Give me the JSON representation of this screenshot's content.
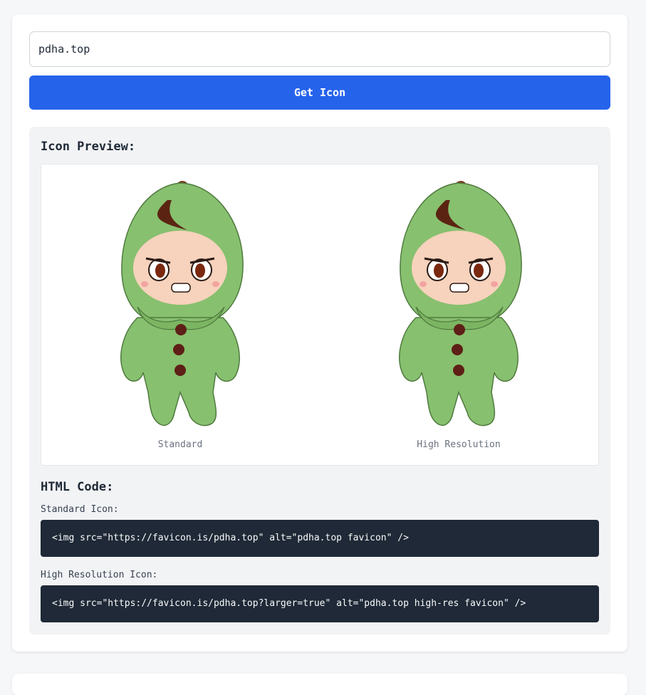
{
  "form": {
    "domain_value": "pdha.top",
    "get_icon_label": "Get Icon"
  },
  "preview": {
    "title": "Icon Preview:",
    "standard_caption": "Standard",
    "highres_caption": "High Resolution"
  },
  "code": {
    "title": "HTML Code:",
    "standard_label": "Standard Icon:",
    "standard_code": "<img src=\"https://favicon.is/pdha.top\" alt=\"pdha.top favicon\" />",
    "highres_label": "High Resolution Icon:",
    "highres_code": "<img src=\"https://favicon.is/pdha.top?larger=true\" alt=\"pdha.top high-res favicon\" />"
  },
  "colors": {
    "accent": "#2563eb",
    "code_bg": "#1f2937",
    "panel_bg": "#f2f3f5"
  }
}
